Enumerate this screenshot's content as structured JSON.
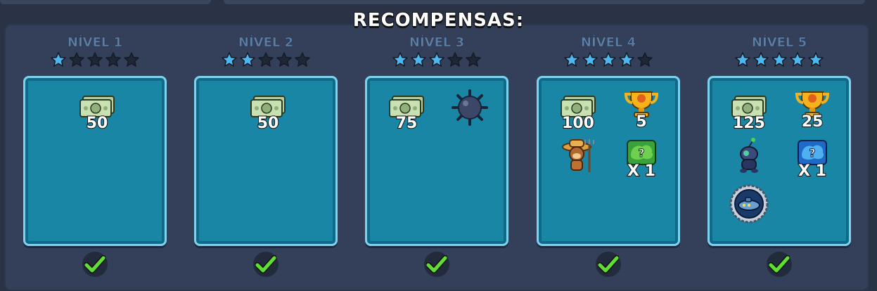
{
  "header": {
    "title": "RECOMPENSAS:"
  },
  "tiers": [
    {
      "label": "NÍVEL 1",
      "stars_filled": 1,
      "stars_total": 5,
      "cash": "50",
      "completed": true
    },
    {
      "label": "NÍVEL 2",
      "stars_filled": 2,
      "stars_total": 5,
      "cash": "50",
      "completed": true
    },
    {
      "label": "NÍVEL 3",
      "stars_filled": 3,
      "stars_total": 5,
      "cash": "75",
      "completed": true,
      "extra_item": "spike-mine-icon"
    },
    {
      "label": "NÍVEL 4",
      "stars_filled": 4,
      "stars_total": 5,
      "cash": "100",
      "trophies": "5",
      "mystery_box": "X 1",
      "extra_item": "farmer-monkey-icon",
      "completed": true
    },
    {
      "label": "NÍVEL 5",
      "stars_filled": 5,
      "stars_total": 5,
      "cash": "125",
      "trophies": "25",
      "mystery_box": "X 1",
      "extra_items": [
        "robot-pet-icon",
        "submarine-badge-icon"
      ],
      "completed": true
    }
  ],
  "colors": {
    "background": "#2a3346",
    "card": "#1a86a6",
    "card_border": "#7fd2ef",
    "star_filled": "#4db8f0",
    "star_empty": "#1f2737",
    "check": "#5fe030"
  }
}
